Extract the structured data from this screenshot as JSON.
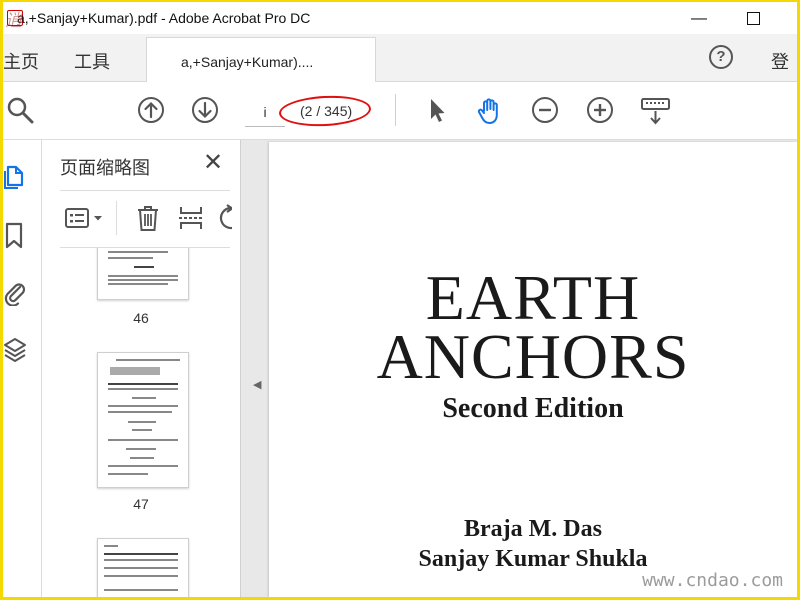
{
  "window": {
    "title": "a,+Sanjay+Kumar).pdf - Adobe Acrobat Pro DC",
    "watermark": "逍",
    "minimize_glyph": "—"
  },
  "nav_tabs": {
    "home": "主页",
    "tools": "工具"
  },
  "doc_tab": {
    "label": "a,+Sanjay+Kumar)...."
  },
  "header": {
    "help_glyph": "?",
    "login": "登"
  },
  "toolbar": {
    "page_input_value": "i",
    "page_count": "(2 / 345)"
  },
  "thumb_panel": {
    "title": "页面缩略图",
    "close_glyph": "✕",
    "pages": [
      "46",
      "47"
    ]
  },
  "document": {
    "title_line1": "EARTH",
    "title_line2": "ANCHORS",
    "edition": "Second Edition",
    "author1": "Braja M. Das",
    "author2": "Sanjay Kumar Shukla"
  },
  "site_watermark": "www.cndao.com",
  "colors": {
    "highlight_ring": "#e01010",
    "frame": "#f5d800",
    "hand_tool": "#1473e6"
  }
}
